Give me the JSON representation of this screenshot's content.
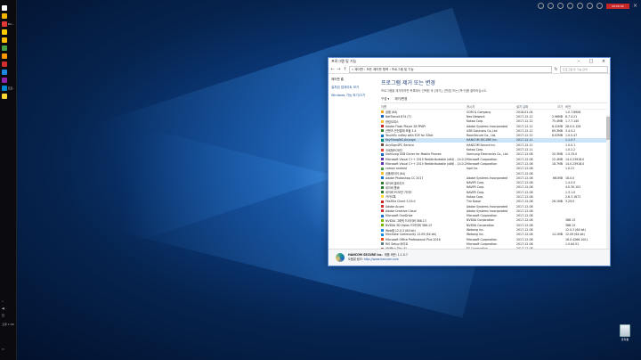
{
  "taskbar": {
    "items": [
      {
        "label": "",
        "color": "#ffffff"
      },
      {
        "label": "",
        "color": "#f4b400"
      },
      {
        "label": "KO...",
        "color": "#e53935"
      },
      {
        "label": "",
        "color": "#ffcc00"
      },
      {
        "label": "",
        "color": "#fbbc05"
      },
      {
        "label": "",
        "color": "#43a047"
      },
      {
        "label": "",
        "color": "#ff9800"
      },
      {
        "label": "",
        "color": "#d32f2f"
      },
      {
        "label": "",
        "color": "#1e88e5"
      },
      {
        "label": "",
        "color": "#8e24aa"
      },
      {
        "label": "프로...",
        "color": "#0288d1"
      },
      {
        "label": "",
        "color": "#fdd835"
      }
    ],
    "tray_time": "오후 1:34",
    "tray_lang": "한"
  },
  "capture": {
    "rec_label": "00:00:00"
  },
  "recycle_bin": {
    "label": "휴지통"
  },
  "window": {
    "title": "프로그램 및 기능",
    "address": "« 제어판 › 모든 제어판 항목 › 프로그램 및 기능",
    "search_placeholder": "프로그램 및 기능 검색",
    "sidebar": {
      "home": "제어판 홈",
      "updates": "설치된 업데이트 보기",
      "features": "Windows 기능 켜기/끄기"
    },
    "heading": "프로그램 제거 또는 변경",
    "subtitle": "프로그램을 제거하려면 목록에서 선택한 후 [제거], [변경] 또는 [복구]를 클릭하십시오.",
    "cmd": {
      "organize": "구성 ▾",
      "uninstall": "제거/변경"
    },
    "columns": {
      "name": "이름",
      "publisher": "게시자",
      "date": "설치 날짜",
      "size": "크기",
      "version": "버전"
    },
    "rows": [
      {
        "name": "곰캠 (64)",
        "publisher": "GOM & Company",
        "date": "2018-01-04",
        "size": "",
        "version": "1.0.7.8908",
        "icon": "#f9a825"
      },
      {
        "name": "NetTransit 874 (T)",
        "publisher": "Neo Network",
        "date": "2017-12-12",
        "size": "2.96MB",
        "version": "8.7.4.21",
        "icon": "#1565c0"
      },
      {
        "name": "한컴오피스",
        "publisher": "Kakao Corp.",
        "date": "2017-12-12",
        "size": "75.4MB",
        "version": "1.7.7.145",
        "icon": "#fbc02d"
      },
      {
        "name": "Adobe Flash Player 28 PPAPI",
        "publisher": "Adobe Systems Incorporated",
        "date": "2017-12-12",
        "size": "8.41MB",
        "version": "28.0.0.126",
        "icon": "#c62828"
      },
      {
        "name": "컨텐츠 안전결제 모듈 3.4",
        "publisher": "USB Solutions Co.,Ltd",
        "date": "2017-12-12",
        "size": "69.3MB",
        "version": "3.4.0.2",
        "icon": "#2e7d32"
      },
      {
        "name": "TouchEn nxKey with E2E for 32bit",
        "publisher": "RaonSecure Co., Ltd.",
        "date": "2017-12-12",
        "size": "6.02MB",
        "version": "1.0.0.47",
        "icon": "#0277bd"
      },
      {
        "name": "KeySharpNG-Anysign",
        "publisher": "HANCOM SECURE Inc.",
        "date": "2017-12-11",
        "size": "",
        "version": "1.1.0.7",
        "icon": "#00897b"
      },
      {
        "name": "AnySign4PC Service",
        "publisher": "HANCOM Secure Inc.",
        "date": "2017-12-11",
        "size": "",
        "version": "1.0.0.1",
        "icon": "#6d4c41"
      },
      {
        "name": "국세청PC보안",
        "publisher": "Kakao Corp.",
        "date": "2017-12-11",
        "size": "",
        "version": "1.0.2.2",
        "icon": "#e53935"
      },
      {
        "name": "Samsung USB Driver for Mobile Phones",
        "publisher": "Samsung Electronics Co., Ltd.",
        "date": "2017-12-08",
        "size": "20.3MB",
        "version": "1.5.33.0",
        "icon": "#1565c0"
      },
      {
        "name": "Microsoft Visual C++ 2015 Redistributable (x64) - 14.0.23...",
        "publisher": "Microsoft Corporation",
        "date": "2017-12-08",
        "size": "22.4MB",
        "version": "14.0.23918.0",
        "icon": "#5e35b1"
      },
      {
        "name": "Microsoft Visual C++ 2015 Redistributable (x86) - 14.0.23...",
        "publisher": "Microsoft Corporation",
        "date": "2017-12-08",
        "size": "18.7MB",
        "version": "14.0.23918.0",
        "icon": "#5e35b1"
      },
      {
        "name": "camon android",
        "publisher": "Ispd Inc.",
        "date": "2017-12-08",
        "size": "",
        "version": "1.0.21",
        "icon": "#43a047"
      },
      {
        "name": "곰플레이어 (64)",
        "publisher": "",
        "date": "2017-12-08",
        "size": "",
        "version": "",
        "icon": "#fbc02d"
      },
      {
        "name": "Adobe Photoshop CC 2017",
        "publisher": "Adobe Systems Incorporated",
        "date": "2017-12-08",
        "size": "661MB",
        "version": "18.0.0",
        "icon": "#1976d2"
      },
      {
        "name": "네이버 클라우드",
        "publisher": "NAVER Corp.",
        "date": "2017-12-08",
        "size": "",
        "version": "1.4.0.0",
        "icon": "#2e7d32"
      },
      {
        "name": "네이버 툴바",
        "publisher": "NAVER Corp.",
        "date": "2017-12-08",
        "size": "",
        "version": "4.0.30.102",
        "icon": "#2e7d32"
      },
      {
        "name": "네이버 PC보안 가이드",
        "publisher": "NAVER Corp.",
        "date": "2017-12-08",
        "size": "",
        "version": "1.3.1.0",
        "icon": "#2e7d32"
      },
      {
        "name": "카카오톡",
        "publisher": "Kakao Corp.",
        "date": "2017-12-08",
        "size": "",
        "version": "2.6.3.1672",
        "icon": "#fdd835"
      },
      {
        "name": "FileZilla Client 3.29.0",
        "publisher": "Tim Kosse",
        "date": "2017-12-08",
        "size": "26.1MB",
        "version": "3.29.0",
        "icon": "#c62828"
      },
      {
        "name": "Adobe Acumi",
        "publisher": "Adobe Systems Incorporated",
        "date": "2017-12-08",
        "size": "",
        "version": "",
        "icon": "#d32f2f"
      },
      {
        "name": "Adobe Creative Cloud",
        "publisher": "Adobe Systems Incorporated",
        "date": "2017-12-08",
        "size": "",
        "version": "",
        "icon": "#d32f2f"
      },
      {
        "name": "Microsoft OneDrive",
        "publisher": "Microsoft Corporation",
        "date": "2017-12-08",
        "size": "",
        "version": "",
        "icon": "#1976d2"
      },
      {
        "name": "NVIDIA 그래픽 드라이버 388.13",
        "publisher": "NVIDIA Corporation",
        "date": "2017-12-08",
        "size": "",
        "version": "388.13",
        "icon": "#76b900"
      },
      {
        "name": "NVIDIA 3D Vision 드라이버 388.13",
        "publisher": "NVIDIA Corporation",
        "date": "2017-12-08",
        "size": "",
        "version": "388.13",
        "icon": "#76b900"
      },
      {
        "name": "Web캠 12.0.3 (64 bit)",
        "publisher": "Webang Inc.",
        "date": "2017-12-08",
        "size": "",
        "version": "12.0.3 (64 bit)",
        "icon": "#1e88e5"
      },
      {
        "name": "Mircinate Community 12.09 (64 bit)",
        "publisher": "Webang Inc.",
        "date": "2017-12-08",
        "size": "14.1MB",
        "version": "12.09 (64 bit)",
        "icon": "#1e88e5"
      },
      {
        "name": "Microsoft Office Professional Plus 2016",
        "publisher": "Microsoft Corporation",
        "date": "2017-12-08",
        "size": "",
        "version": "16.0.4266.1001",
        "icon": "#e64a19"
      },
      {
        "name": "RIS Setup 바이트",
        "publisher": "Microsoft Corporation",
        "date": "2017-12-08",
        "size": "",
        "version": "1.0.64.51",
        "icon": "#607d8b"
      },
      {
        "name": "ANIPlus File (X)",
        "publisher": "ES Corporation",
        "date": "2017-12-08",
        "size": "",
        "version": "",
        "icon": "#8d6e63"
      }
    ],
    "details": {
      "publisher": "HANCOM SECURE Inc.",
      "product_version_label": "제품 버전:",
      "product_version": "1.1.0.7",
      "support_link_label": "도움말 링크:",
      "support_link": "http://www.hancom.com"
    }
  }
}
